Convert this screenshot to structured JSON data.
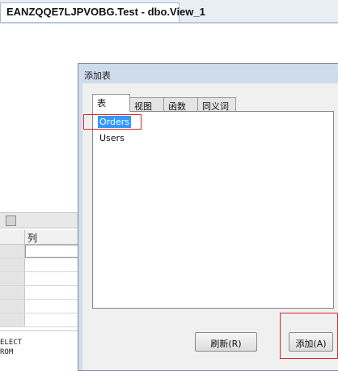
{
  "document_tab": {
    "title": "EANZQQE7LJPVOBG.Test - dbo.View_1"
  },
  "criteria_grid": {
    "column_header": "列",
    "rows": 6
  },
  "sql_pane": {
    "lines": [
      "ELECT",
      "ROM"
    ]
  },
  "dialog": {
    "title": "添加表",
    "tabs": [
      "表",
      "视图",
      "函数",
      "同义词"
    ],
    "active_tab": "表",
    "items": [
      "Orders",
      "Users"
    ],
    "selected_item": "Orders",
    "buttons": {
      "refresh": "刷新(R)",
      "add": "添加(A)"
    }
  },
  "colors": {
    "selection": "#3399ff",
    "highlight_box": "#e02424",
    "dialog_frame": "#cfdcec"
  }
}
